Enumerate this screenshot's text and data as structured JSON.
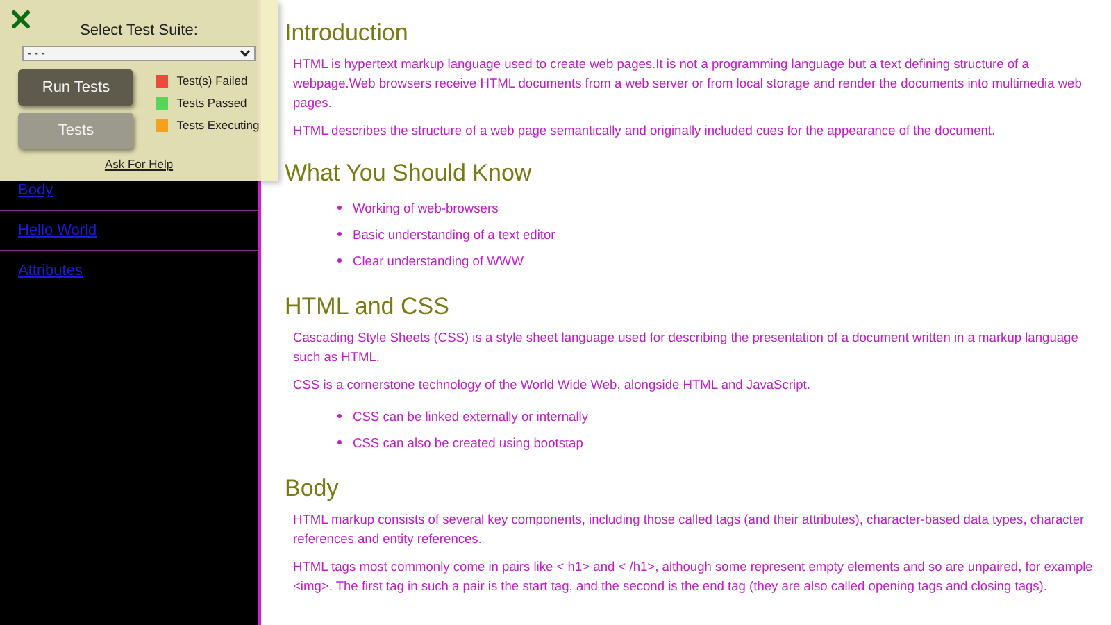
{
  "sidebar": {
    "items": [
      {
        "label": "Body"
      },
      {
        "label": "Hello World"
      },
      {
        "label": "Attributes"
      }
    ]
  },
  "test_panel": {
    "label": "Select Test Suite:",
    "suite_select": {
      "value": "- - -"
    },
    "buttons": [
      {
        "label": "Run Tests",
        "kind": "primary"
      },
      {
        "label": "Tests",
        "kind": "secondary"
      }
    ],
    "legend": [
      {
        "label": "Test(s) Failed",
        "color": "#f0483a"
      },
      {
        "label": "Tests Passed",
        "color": "#56d556"
      },
      {
        "label": "Tests Executing",
        "color": "#f4a21e"
      }
    ],
    "help_link": "Ask For Help"
  },
  "sections": [
    {
      "heading": "Introduction",
      "blocks": [
        {
          "kind": "paragraph",
          "text": "HTML is hypertext markup language used to create web pages.It is not a programming language but a text defining structure of a webpage.Web browsers receive HTML documents from a web server or from local storage and render the documents into multimedia web pages."
        },
        {
          "kind": "paragraph",
          "text": "HTML describes the structure of a web page semantically and originally included cues for the appearance of the document."
        }
      ]
    },
    {
      "heading": "What You Should Know",
      "blocks": [
        {
          "kind": "list",
          "items": [
            "Working of web-browsers",
            "Basic understanding of a text editor",
            "Clear understanding of WWW"
          ]
        }
      ]
    },
    {
      "heading": "HTML and CSS",
      "blocks": [
        {
          "kind": "paragraph",
          "text": "Cascading Style Sheets (CSS) is a style sheet language used for describing the presentation of a document written in a markup language such as HTML."
        },
        {
          "kind": "paragraph",
          "text": "CSS is a cornerstone technology of the World Wide Web, alongside HTML and JavaScript."
        },
        {
          "kind": "list",
          "items": [
            "CSS can be linked externally or internally",
            "CSS can also be created using bootstap"
          ]
        }
      ]
    },
    {
      "heading": "Body",
      "blocks": [
        {
          "kind": "paragraph",
          "text": "HTML markup consists of several key components, including those called tags (and their attributes), character-based data types, character references and entity references."
        },
        {
          "kind": "paragraph",
          "text": "HTML tags most commonly come in pairs like < h1> and < /h1>, although some represent empty elements and so are unpaired, for example <img>. The first tag in such a pair is the start tag, and the second is the end tag (they are also called opening tags and closing tags)."
        }
      ]
    }
  ]
}
